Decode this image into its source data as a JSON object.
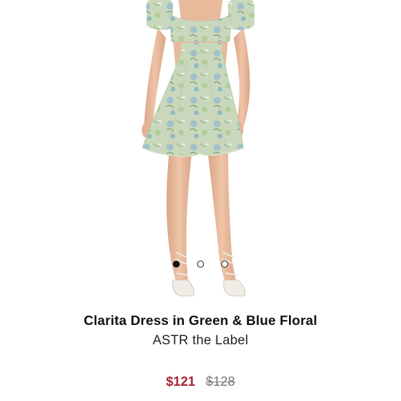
{
  "product": {
    "title": "Clarita Dress in Green & Blue Floral",
    "brand": "ASTR the Label",
    "price_sale": "$121",
    "price_original": "$128",
    "image_alt": "Model wearing floral mini dress"
  },
  "carousel": {
    "total": 3,
    "active_index": 0
  },
  "colors": {
    "sale_price": "#a82535",
    "original_price": "#777777",
    "dress_base": "#c9d8bd",
    "floral_accent": "#7fb1c6",
    "skin": "#e8b99b"
  }
}
